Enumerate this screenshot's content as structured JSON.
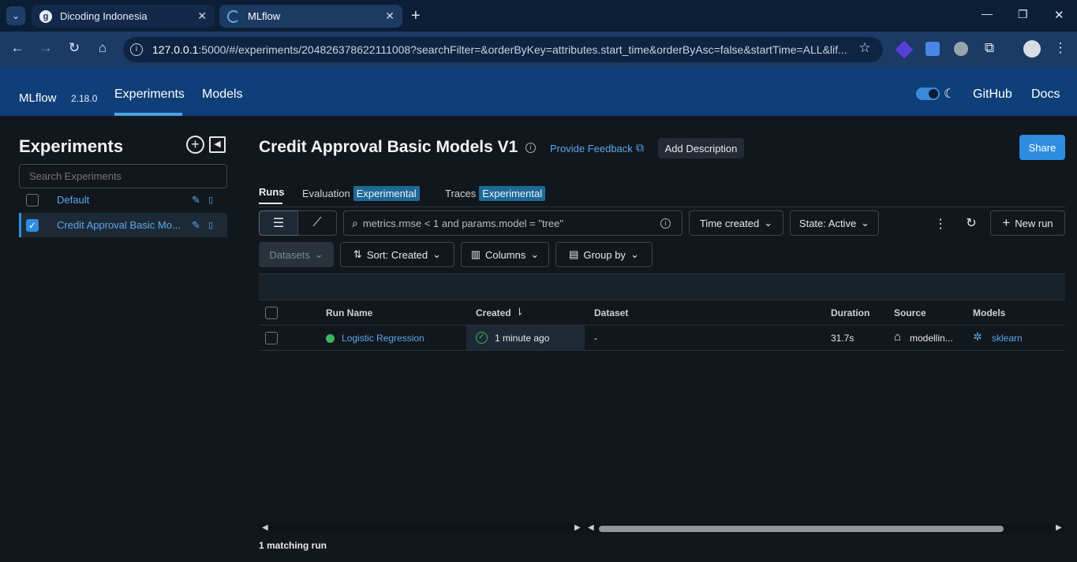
{
  "browser": {
    "tabs": [
      {
        "title": "Dicoding Indonesia",
        "icon": "dicoding-favicon"
      },
      {
        "title": "MLflow",
        "icon": "loading-spinner"
      }
    ],
    "url_host": "127.0.0.1",
    "url_rest": ":5000/#/experiments/204826378622111008?searchFilter=&orderByKey=attributes.start_time&orderByAsc=false&startTime=ALL&lif...",
    "new_tab": "+",
    "min": "—",
    "restore": "❐",
    "close": "✕"
  },
  "header": {
    "logo_alt": "MLflow",
    "version": "2.18.0",
    "nav": [
      "Experiments",
      "Models"
    ],
    "right_links": [
      "GitHub",
      "Docs"
    ]
  },
  "sidebar": {
    "title": "Experiments",
    "search_placeholder": "Search Experiments",
    "items": [
      {
        "name": "Default",
        "checked": false
      },
      {
        "name": "Credit Approval Basic Mo...",
        "checked": true
      }
    ]
  },
  "main": {
    "title": "Credit Approval Basic Models V1",
    "feedback_link": "Provide Feedback",
    "add_description": "Add Description",
    "share": "Share",
    "tabs": [
      {
        "label": "Runs"
      },
      {
        "label": "Evaluation",
        "badge": "Experimental"
      },
      {
        "label": "Traces",
        "badge": "Experimental"
      }
    ],
    "search_placeholder": "metrics.rmse < 1 and params.model = \"tree\"",
    "time_filter": "Time created",
    "state_filter": "State: Active",
    "new_run": "New run",
    "datasets": "Datasets",
    "sort": "Sort: Created",
    "columns": "Columns",
    "group_by": "Group by",
    "table": {
      "headers": [
        "Run Name",
        "Created",
        "Dataset",
        "Duration",
        "Source",
        "Models"
      ],
      "rows": [
        {
          "run_name": "Logistic Regression",
          "created": "1 minute ago",
          "dataset": "-",
          "duration": "31.7s",
          "source": "modellin...",
          "models": "sklearn"
        }
      ]
    },
    "footer": "1 matching run"
  },
  "colors": {
    "accent": "#2e8de1",
    "header_bg": "#0f3f78",
    "success": "#3cb55e"
  }
}
